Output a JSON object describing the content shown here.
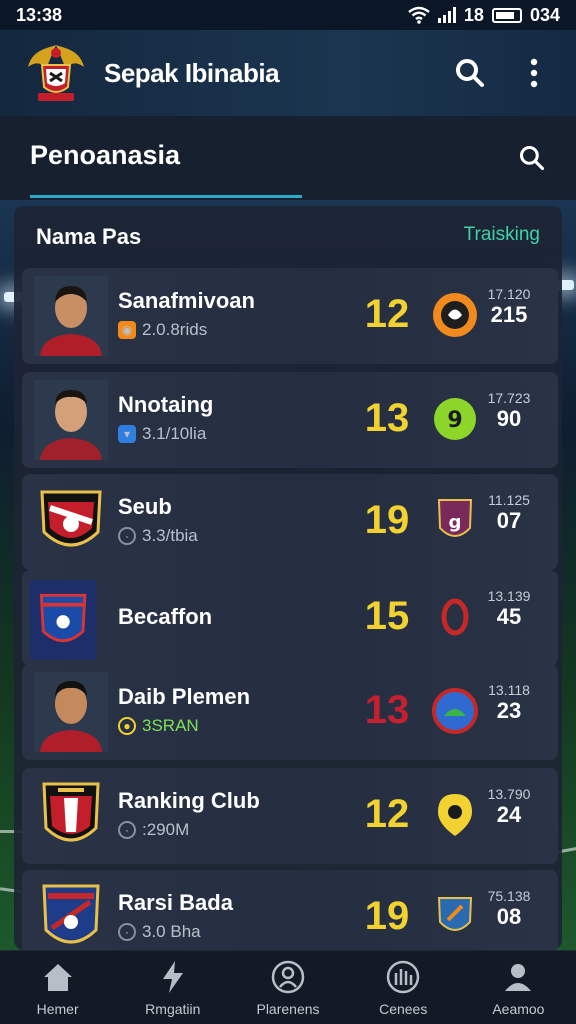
{
  "status": {
    "time": "13:38",
    "right_text": "18",
    "battery_text": "034"
  },
  "app": {
    "title": "Sepak Ibinabia"
  },
  "section": {
    "title": "Penoanasia"
  },
  "panel": {
    "left_header": "Nama Pas",
    "right_header": "Traisking"
  },
  "rows": [
    {
      "name": "Sanafmivoan",
      "meta": "2.0.8rids",
      "score": "12",
      "score_color": "#f2d230",
      "stat_top": "17.120",
      "stat_main": "215",
      "badge_color": "#f08a1c",
      "meta_icon_color": "#f08a1c"
    },
    {
      "name": "Nnotaing",
      "meta": "3.1/10lia",
      "score": "13",
      "score_color": "#f2d230",
      "stat_top": "17.723",
      "stat_main": "90",
      "badge_color": "#8cd62a",
      "meta_icon_color": "#2f7fe0"
    },
    {
      "name": "Seub",
      "meta": "3.3/tbia",
      "score": "19",
      "score_color": "#f2d230",
      "stat_top": "11.125",
      "stat_main": "07",
      "badge_color": "#7a2a5a",
      "meta_icon_color": "#8a8f98"
    },
    {
      "name": "Becaffon",
      "meta": "",
      "score": "15",
      "score_color": "#f2d230",
      "stat_top": "13.139",
      "stat_main": "45",
      "badge_color": "#c62828",
      "meta_icon_color": ""
    },
    {
      "name": "Daib Plemen",
      "meta": "3SRAN",
      "score": "13",
      "score_color": "#c42030",
      "stat_top": "13.118",
      "stat_main": "23",
      "badge_color": "#2f6ad0",
      "meta_icon_color": "#f2d230",
      "meta_color": "#7fe05a"
    },
    {
      "name": "Ranking Club",
      "meta": ":290M",
      "score": "12",
      "score_color": "#f2d230",
      "stat_top": "13.790",
      "stat_main": "24",
      "badge_color": "#f2d230",
      "meta_icon_color": "#8a8f98"
    },
    {
      "name": "Rarsi Bada",
      "meta": "3.0 Bha",
      "score": "19",
      "score_color": "#f2d230",
      "stat_top": "75.138",
      "stat_main": "08",
      "badge_color": "#2a6ab0",
      "meta_icon_color": "#8a8f98"
    }
  ],
  "nav": [
    {
      "label": "Hemer",
      "icon": "home-icon"
    },
    {
      "label": "Rmgatiin",
      "icon": "bolt-icon"
    },
    {
      "label": "Plarenens",
      "icon": "player-icon"
    },
    {
      "label": "Cenees",
      "icon": "stadium-icon"
    },
    {
      "label": "Aeamoo",
      "icon": "profile-icon"
    }
  ]
}
